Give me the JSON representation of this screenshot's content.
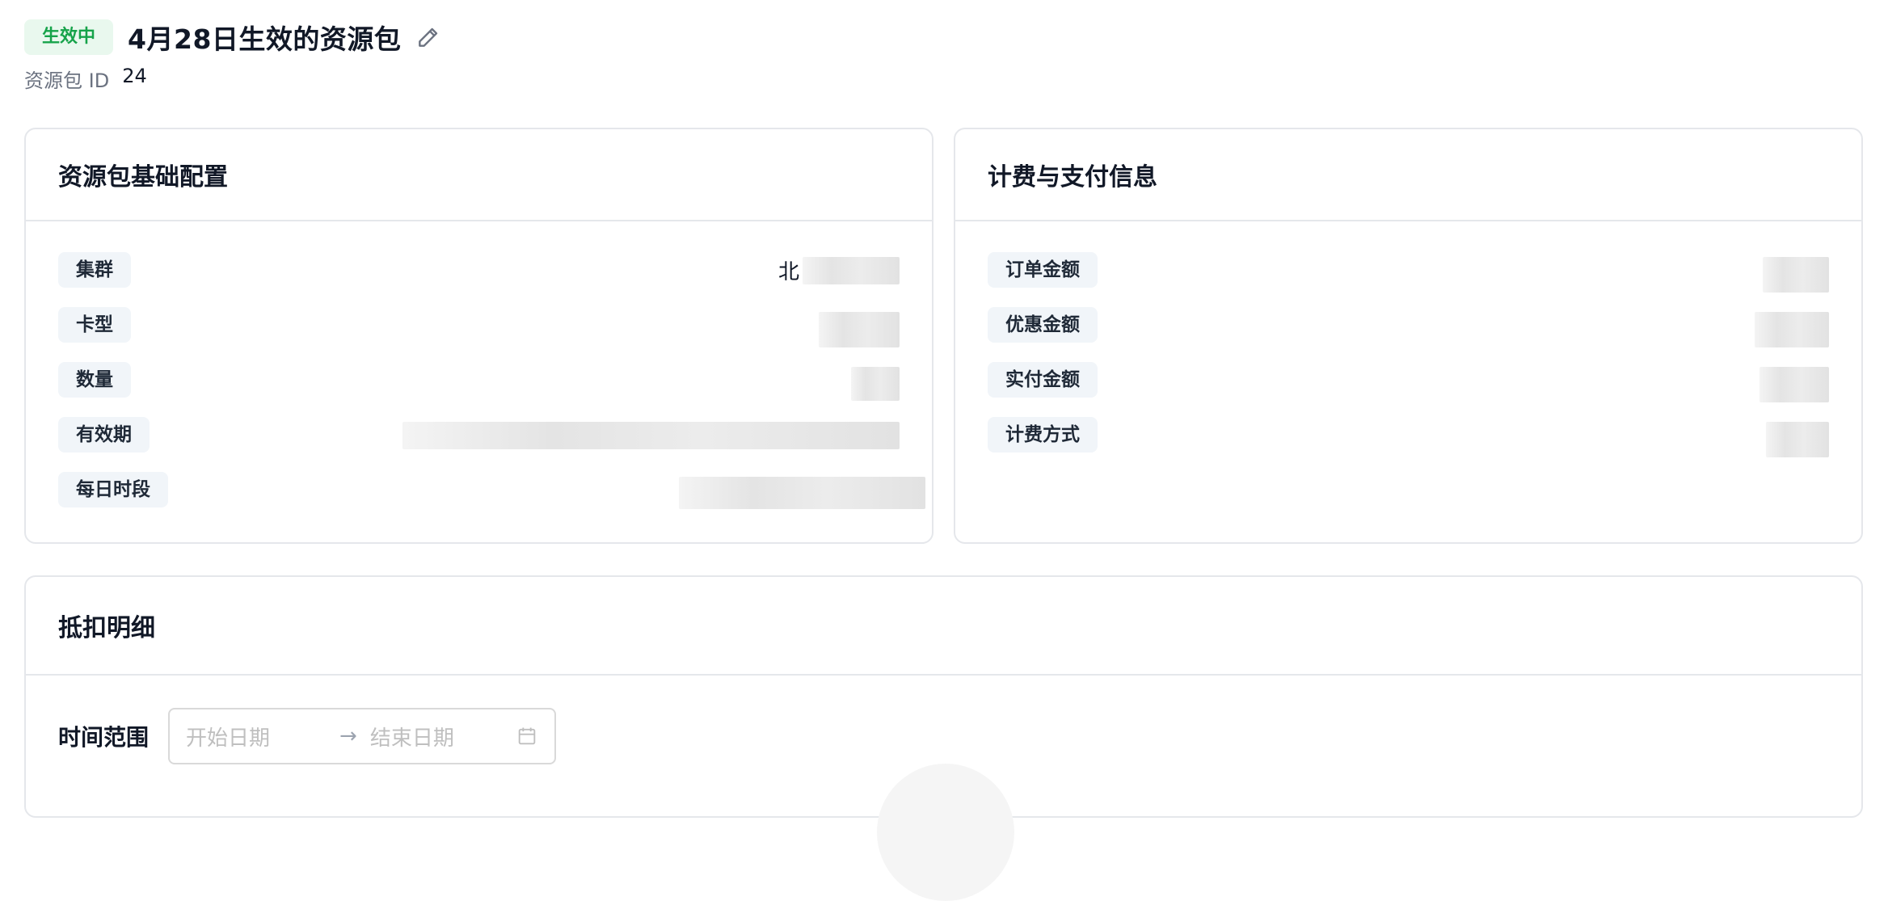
{
  "header": {
    "status": "生效中",
    "title": "4月28日生效的资源包",
    "id_label": "资源包 ID",
    "id_value": "24"
  },
  "basic_config": {
    "title": "资源包基础配置",
    "rows": [
      {
        "label": "集群",
        "value_partial": "北"
      },
      {
        "label": "卡型"
      },
      {
        "label": "数量"
      },
      {
        "label": "有效期"
      },
      {
        "label": "每日时段"
      }
    ]
  },
  "billing": {
    "title": "计费与支付信息",
    "rows": [
      {
        "label": "订单金额"
      },
      {
        "label": "优惠金额"
      },
      {
        "label": "实付金额"
      },
      {
        "label": "计费方式"
      }
    ]
  },
  "deduction": {
    "title": "抵扣明细",
    "filter_label": "时间范围",
    "start_placeholder": "开始日期",
    "separator": "→",
    "end_placeholder": "结束日期"
  },
  "colors": {
    "status_bg": "#e9f8ee",
    "status_text": "#16a34a",
    "border": "#e5e7eb",
    "pill_bg": "#f1f5f9"
  }
}
